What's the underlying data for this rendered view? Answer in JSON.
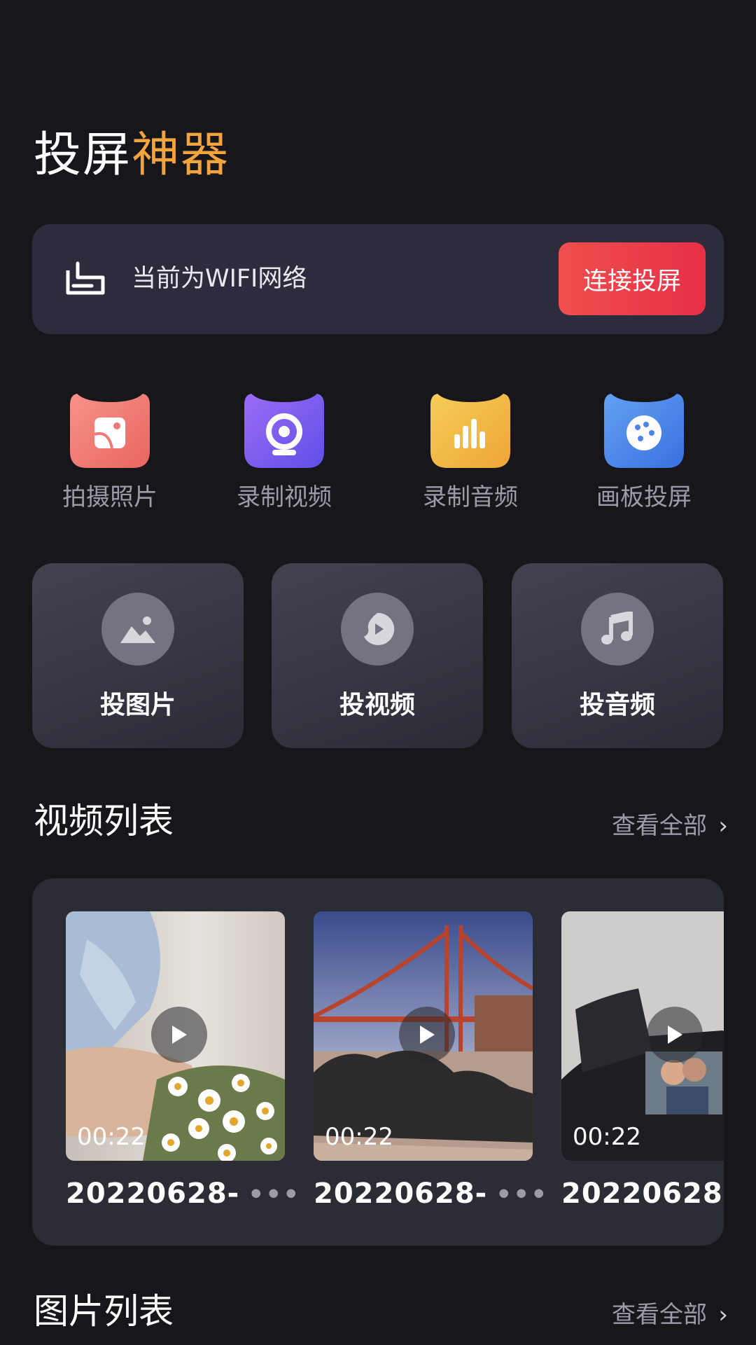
{
  "header": {
    "title_part1": "投屏",
    "title_part2": "神器"
  },
  "network": {
    "status_text": "当前为WIFI网络",
    "connect_label": "连接投屏",
    "icon": "router-icon"
  },
  "quick_actions": [
    {
      "label": "拍摄照片",
      "icon": "photo-icon",
      "color": "#ee7a76"
    },
    {
      "label": "录制视频",
      "icon": "webcam-icon",
      "color": "#7860f0"
    },
    {
      "label": "录制音频",
      "icon": "audio-bars-icon",
      "color": "#f1b840"
    },
    {
      "label": "画板投屏",
      "icon": "palette-icon",
      "color": "#4b84ea"
    }
  ],
  "cast_options": [
    {
      "label": "投图片",
      "icon": "image-icon"
    },
    {
      "label": "投视频",
      "icon": "video-disc-icon"
    },
    {
      "label": "投音频",
      "icon": "music-note-icon"
    }
  ],
  "video_section": {
    "title": "视频列表",
    "see_all": "查看全部",
    "items": [
      {
        "name": "20220628-",
        "duration": "00:22"
      },
      {
        "name": "20220628-",
        "duration": "00:22"
      },
      {
        "name": "20220628",
        "duration": "00:22"
      }
    ],
    "more_symbol": "•••"
  },
  "image_section": {
    "title": "图片列表",
    "see_all": "查看全部"
  },
  "colors": {
    "accent": "#f3a43c",
    "button": "#e93d4a",
    "background": "#16161b"
  }
}
